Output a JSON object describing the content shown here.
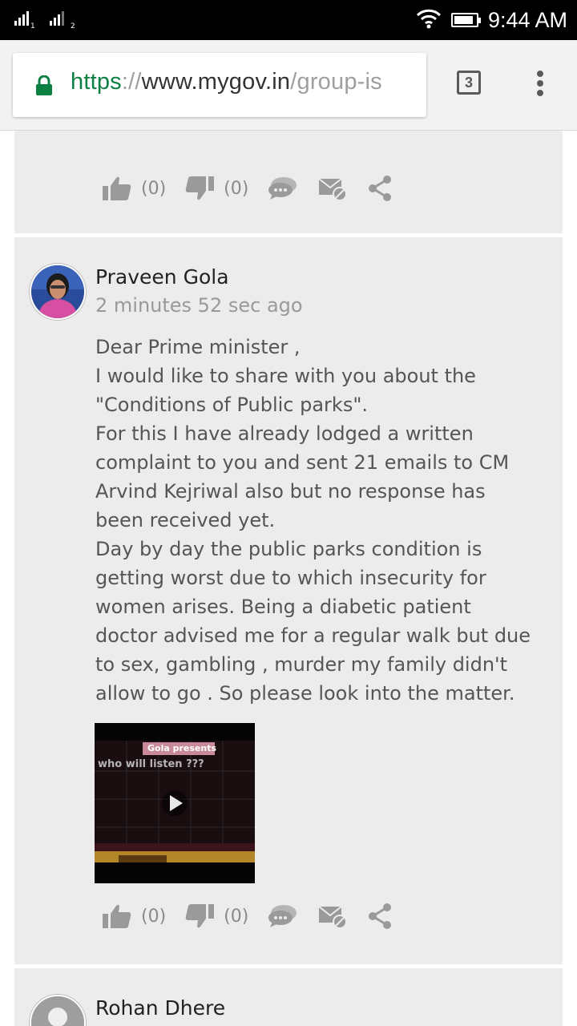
{
  "status_bar": {
    "sim1_label": "1",
    "sim2_label": "2",
    "time": "9:44 AM",
    "battery_level": 0.9,
    "icons": [
      "signal-icon",
      "signal-icon",
      "wifi-icon",
      "battery-icon"
    ]
  },
  "browser": {
    "url_scheme": "https",
    "url_separator": "://",
    "url_host": "www.mygov.in",
    "url_path": "/group-is",
    "tab_count": "3",
    "secure_color": "#0b8043"
  },
  "posts": [
    {
      "likes": "(0)",
      "dislikes": "(0)"
    },
    {
      "author": "Praveen Gola",
      "time": "2 minutes 52 sec ago",
      "body_lines": [
        "Dear Prime minister ,",
        "I would like to share with you about the",
        "\"Conditions of Public parks\".",
        "For this I have already lodged a written",
        "complaint to you and sent 21 emails to CM",
        "Arvind Kejriwal also but no response has",
        "been received yet.",
        "Day by day the public parks condition is",
        "getting worst due to which insecurity for",
        "women arises. Being a diabetic patient",
        "doctor advised me for a regular walk but due",
        "to sex, gambling , murder my family didn't",
        "allow to go . So please look into the matter."
      ],
      "video_title": "Gola presents",
      "video_subtitle": "who will listen ???",
      "likes": "(0)",
      "dislikes": "(0)"
    },
    {
      "author": "Rohan Dhere"
    }
  ],
  "colors": {
    "card_background": "#ececec",
    "icon_gray": "#9a9a9a",
    "meta_text": "#999999"
  }
}
